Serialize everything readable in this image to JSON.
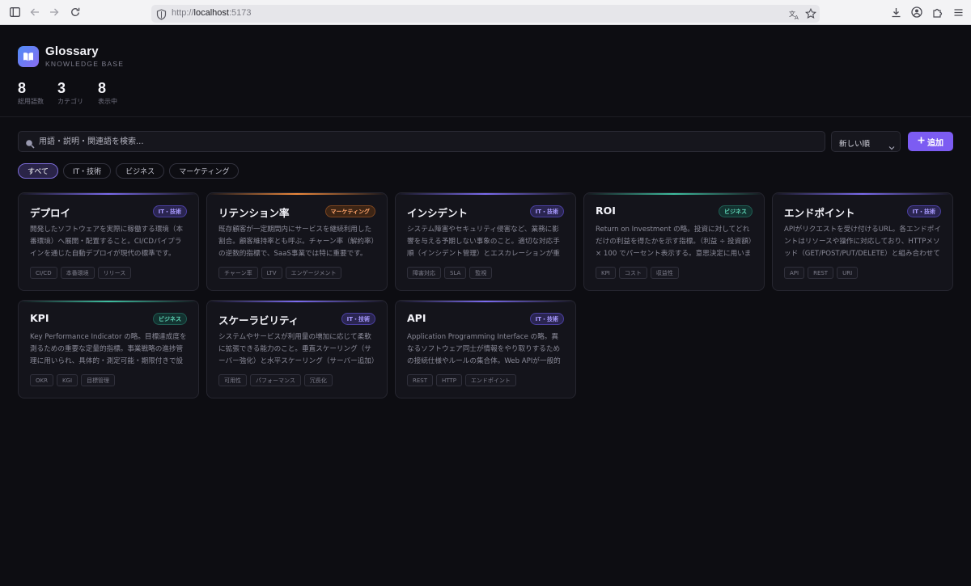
{
  "browser": {
    "url_prefix": "http://",
    "url_host": "localhost",
    "url_port": ":5173"
  },
  "app": {
    "title": "Glossary",
    "subtitle": "KNOWLEDGE BASE",
    "stats": [
      {
        "value": "8",
        "label": "総用語数"
      },
      {
        "value": "3",
        "label": "カテゴリ"
      },
      {
        "value": "8",
        "label": "表示中"
      }
    ],
    "search_placeholder": "用語・説明・関連語を検索...",
    "sort_value": "新しい順",
    "add_label": "追加",
    "filters": [
      "すべて",
      "IT・技術",
      "ビジネス",
      "マーケティング"
    ],
    "active_filter": "すべて"
  },
  "colors": {
    "it": "#7c6cf0",
    "biz": "#3fbfa0",
    "mkt": "#f08a3c"
  },
  "cards": [
    {
      "title": "デプロイ",
      "category": "IT・技術",
      "kind": "it",
      "desc": "開発したソフトウェアを実際に稼働する環境（本番環境）へ展開・配置すること。CI/CDパイプラインを通じた自動デプロイが現代の標準です。",
      "tags": [
        "CI/CD",
        "本番環境",
        "リリース"
      ]
    },
    {
      "title": "リテンション率",
      "category": "マーケティング",
      "kind": "mkt",
      "desc": "既存顧客が一定期間内にサービスを継続利用した割合。顧客維持率とも呼ぶ。チャーン率（解約率）の逆数的指標で、SaaS事業では特に重要です。",
      "tags": [
        "チャーン率",
        "LTV",
        "エンゲージメント"
      ]
    },
    {
      "title": "インシデント",
      "category": "IT・技術",
      "kind": "it",
      "desc": "システム障害やセキュリティ侵害など、業務に影響を与える予期しない事象のこと。適切な対応手順（インシデント管理）とエスカレーションが重要です。",
      "tags": [
        "障害対応",
        "SLA",
        "監視"
      ]
    },
    {
      "title": "ROI",
      "category": "ビジネス",
      "kind": "biz",
      "desc": "Return on Investment の略。投資に対してどれだけの利益を得たかを示す指標。（利益 ÷ 投資額）× 100 でパーセント表示する。意思決定に用います。",
      "tags": [
        "KPI",
        "コスト",
        "収益性"
      ]
    },
    {
      "title": "エンドポイント",
      "category": "IT・技術",
      "kind": "it",
      "desc": "APIがリクエストを受け付けるURL。各エンドポイントはリソースや操作に対応しており、HTTPメソッド（GET/POST/PUT/DELETE）と組み合わせて使います。",
      "tags": [
        "API",
        "REST",
        "URI"
      ]
    },
    {
      "title": "KPI",
      "category": "ビジネス",
      "kind": "biz",
      "desc": "Key Performance Indicator の略。目標達成度を測るための重要な定量的指標。事業戦略の進捗管理に用いられ、具体的・測定可能・期限付きで設定します。",
      "tags": [
        "OKR",
        "KGI",
        "目標管理"
      ]
    },
    {
      "title": "スケーラビリティ",
      "category": "IT・技術",
      "kind": "it",
      "desc": "システムやサービスが利用量の増加に応じて柔軟に拡張できる能力のこと。垂直スケーリング（サーバー強化）と水平スケーリング（サーバー追加）があります。",
      "tags": [
        "可用性",
        "パフォーマンス",
        "冗長化"
      ]
    },
    {
      "title": "API",
      "category": "IT・技術",
      "kind": "it",
      "desc": "Application Programming Interface の略。異なるソフトウェア同士が情報をやり取りするための接続仕様やルールの集合体。Web APIが一般的です。",
      "tags": [
        "REST",
        "HTTP",
        "エンドポイント"
      ]
    }
  ]
}
